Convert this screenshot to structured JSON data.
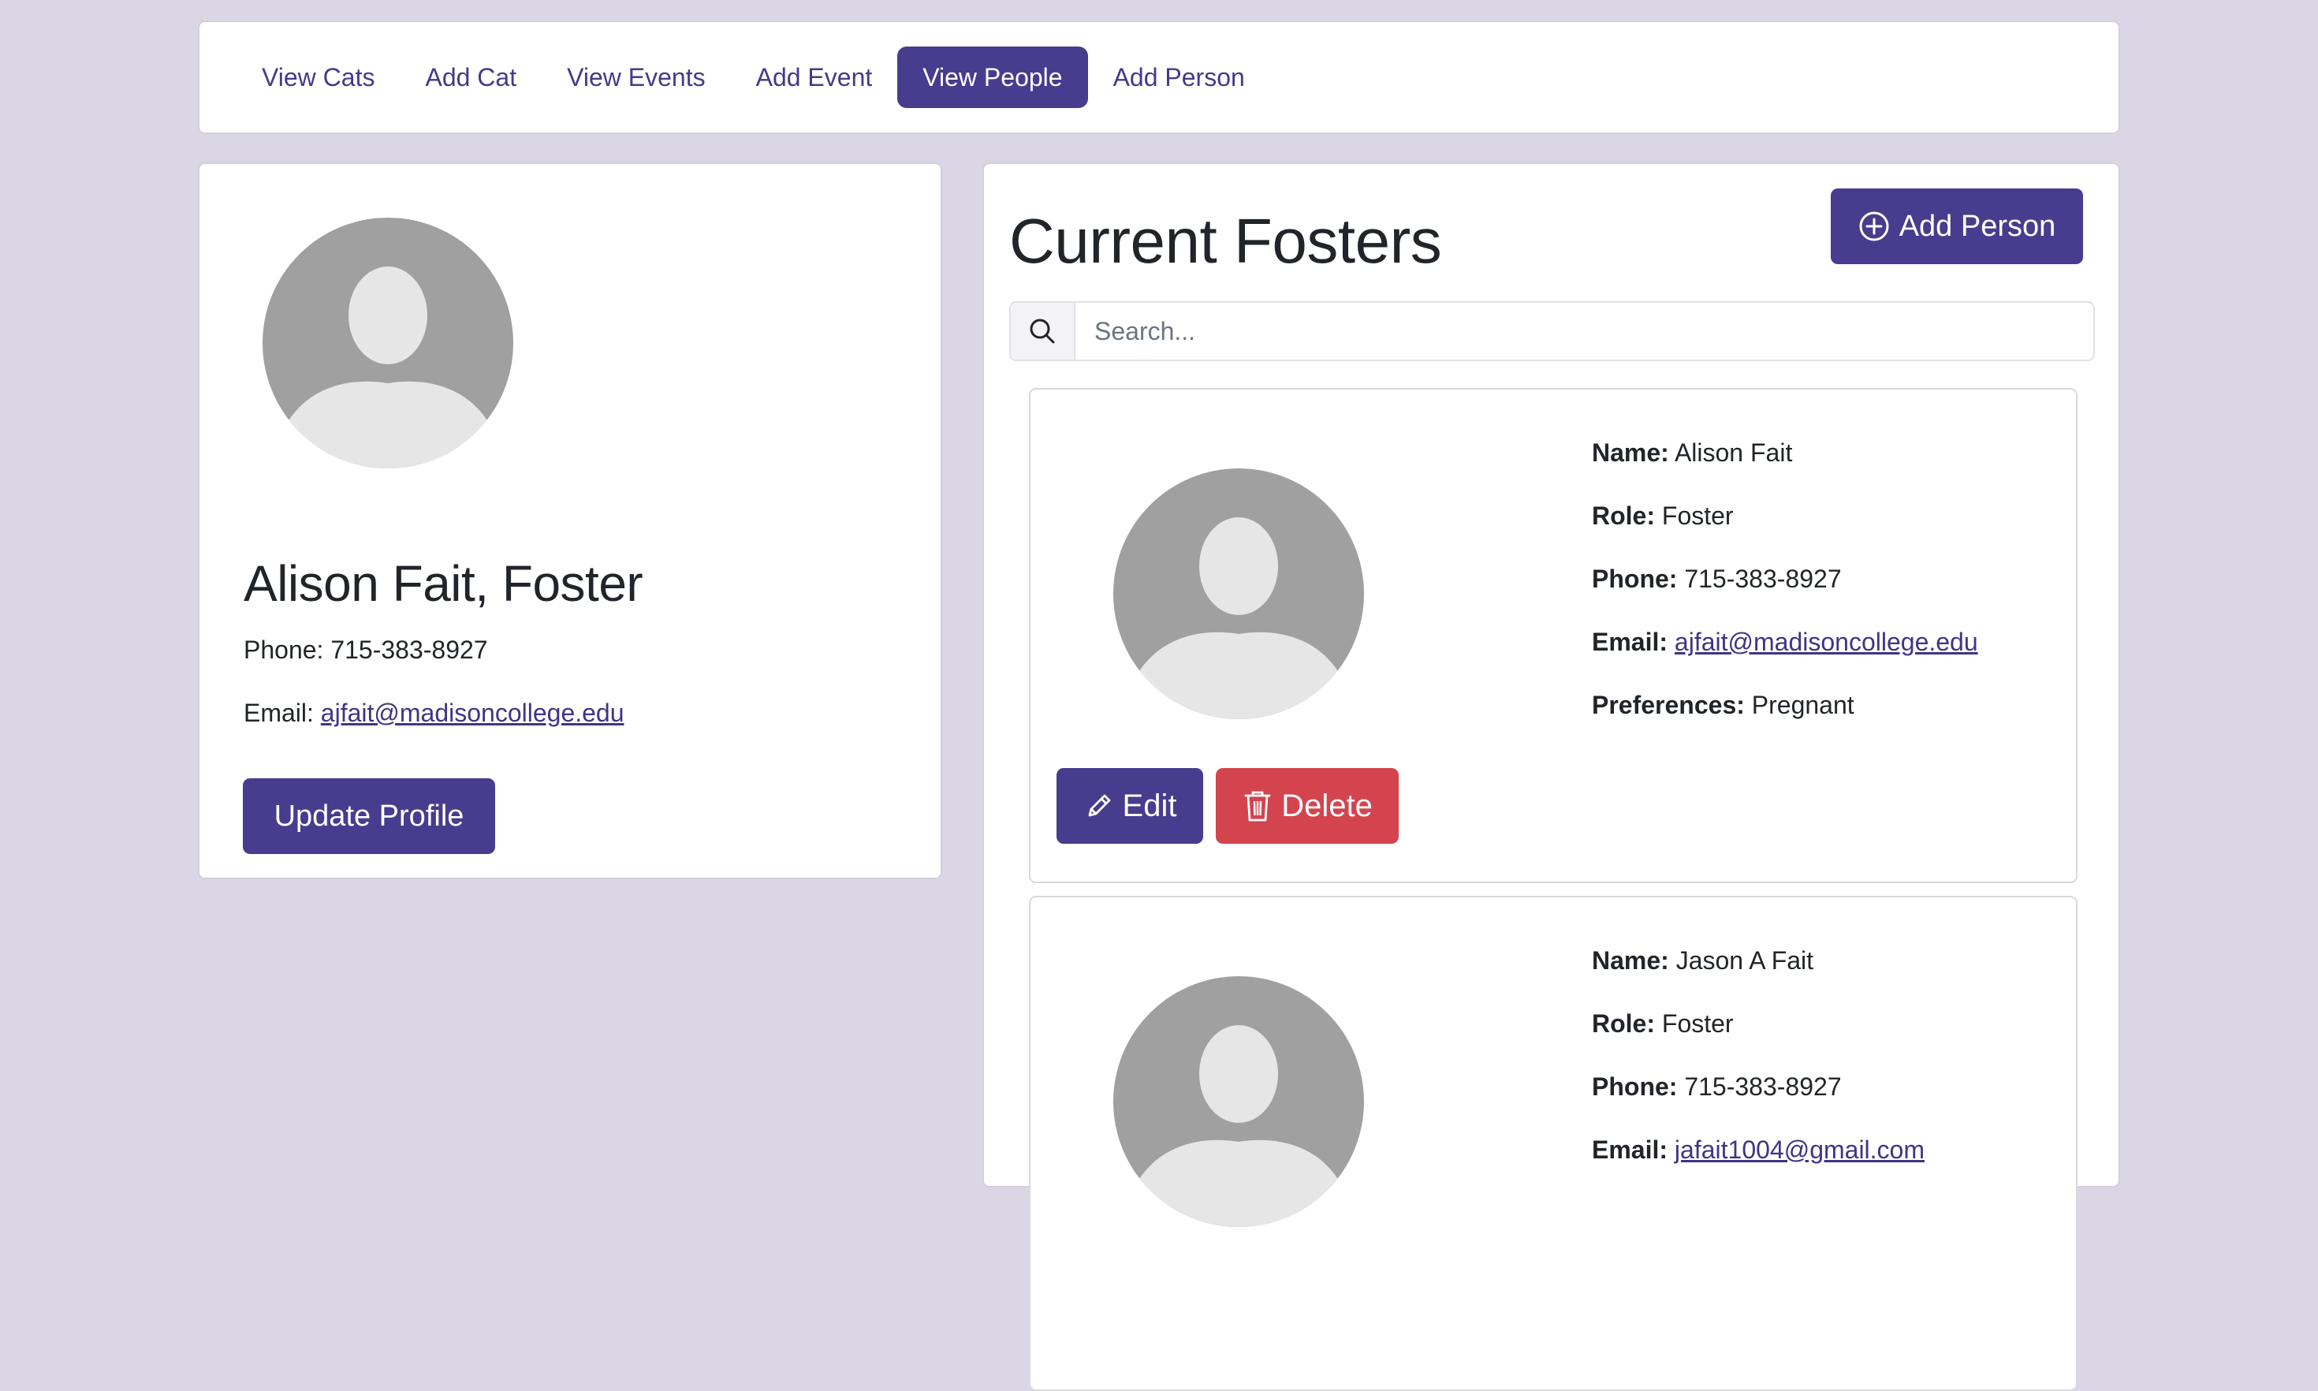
{
  "nav": {
    "items": [
      {
        "label": "View Cats",
        "active": false
      },
      {
        "label": "Add Cat",
        "active": false
      },
      {
        "label": "View Events",
        "active": false
      },
      {
        "label": "Add Event",
        "active": false
      },
      {
        "label": "View People",
        "active": true
      },
      {
        "label": "Add Person",
        "active": false
      }
    ]
  },
  "profile": {
    "heading": "Alison Fait, Foster",
    "phone_label": "Phone:",
    "phone": "715-383-8927",
    "email_label": "Email:",
    "email": "ajfait@madisoncollege.edu",
    "update_label": "Update Profile"
  },
  "fosters": {
    "title": "Current Fosters",
    "add_label": "Add Person",
    "search_placeholder": "Search...",
    "edit_label": "Edit",
    "delete_label": "Delete",
    "labels": {
      "name": "Name:",
      "role": "Role:",
      "phone": "Phone:",
      "email": "Email:",
      "preferences": "Preferences:"
    },
    "people": [
      {
        "name": "Alison Fait",
        "role": "Foster",
        "phone": "715-383-8927",
        "email": "ajfait@madisoncollege.edu",
        "preferences": "Pregnant"
      },
      {
        "name": "Jason A Fait",
        "role": "Foster",
        "phone": "715-383-8927",
        "email": "jafait1004@gmail.com"
      }
    ]
  },
  "colors": {
    "primary": "#473c8d",
    "danger": "#d4444f",
    "background": "#dad6e6",
    "avatar_dark": "#a0a0a0",
    "avatar_light": "#e6e6e6"
  },
  "icons": {
    "search": "search-icon",
    "add": "plus-circle-icon",
    "edit": "pencil-icon",
    "delete": "trash-icon",
    "avatar": "user-avatar-icon"
  }
}
